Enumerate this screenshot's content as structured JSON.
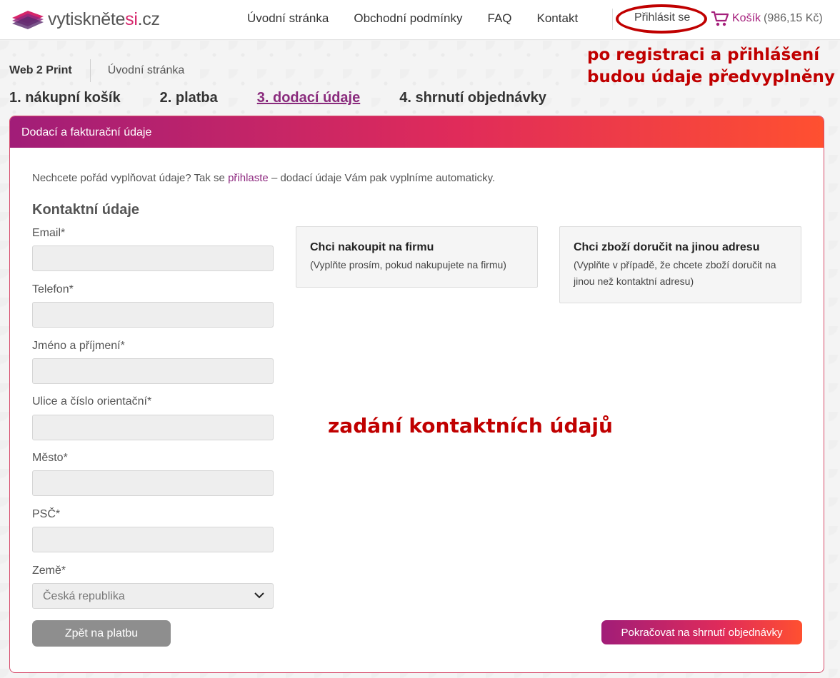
{
  "header": {
    "logo_main": "vytiskněte",
    "logo_accent": "si",
    "logo_tld": ".cz",
    "nav": [
      {
        "label": "Úvodní stránka"
      },
      {
        "label": "Obchodní podmínky"
      },
      {
        "label": "FAQ"
      },
      {
        "label": "Kontakt"
      }
    ],
    "login": "Přihlásit se",
    "cart_label": "Košík",
    "cart_price": "(986,15 Kč)"
  },
  "breadcrumb": {
    "home": "Web 2 Print",
    "current": "Úvodní stránka"
  },
  "steps": [
    {
      "label": "1. nákupní košík",
      "active": false
    },
    {
      "label": "2. platba",
      "active": false
    },
    {
      "label": "3. dodací údaje",
      "active": true
    },
    {
      "label": "4. shrnutí objednávky",
      "active": false
    }
  ],
  "annotations": {
    "top": "po registraci a přihlášení budou údaje předvyplněny",
    "middle": "zadání kontaktních údajů"
  },
  "panel": {
    "title": "Dodací a fakturační údaje",
    "intro_before": "Nechcete pořád vyplňovat údaje? Tak se ",
    "intro_link": "přihlaste",
    "intro_after": " – dodací údaje Vám pak vyplníme automaticky.",
    "section_title": "Kontaktní údaje",
    "fields": [
      {
        "label": "Email*",
        "value": ""
      },
      {
        "label": "Telefon*",
        "value": ""
      },
      {
        "label": "Jméno a příjmení*",
        "value": ""
      },
      {
        "label": "Ulice a číslo orientační*",
        "value": ""
      },
      {
        "label": "Město*",
        "value": ""
      },
      {
        "label": "PSČ*",
        "value": ""
      }
    ],
    "country_label": "Země*",
    "country_value": "Česká republika",
    "company_option": {
      "title": "Chci nakoupit na firmu",
      "desc": "(Vyplňte prosím, pokud nakupujete na firmu)"
    },
    "address_option": {
      "title": "Chci zboží doručit na jinou adresu",
      "desc": "(Vyplňte v případě, že chcete zboží doručit na jinou než kontaktní adresu)"
    },
    "back_button": "Zpět na platbu",
    "next_button": "Pokračovat na shrnutí objednávky"
  },
  "colors": {
    "accent": "#a5207c",
    "gradient_start": "#a11d78",
    "gradient_end": "#ff5030",
    "annotation": "#c00000"
  }
}
